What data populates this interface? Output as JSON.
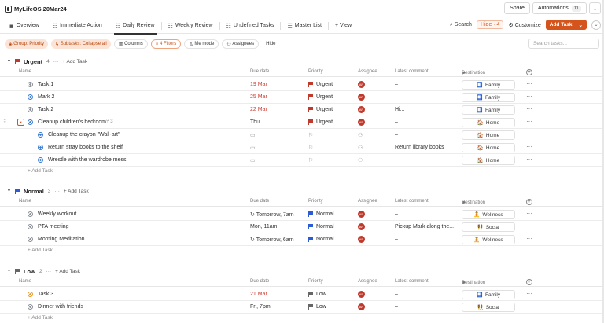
{
  "app": {
    "title": "MyLifeOS 20Mar24"
  },
  "top_actions": {
    "share": "Share",
    "automations": "Automations",
    "automations_count": "11"
  },
  "tabs": [
    {
      "label": "Overview",
      "icon": "▣"
    },
    {
      "label": "Immediate Action",
      "icon": "☷"
    },
    {
      "label": "Daily Review",
      "icon": "☷"
    },
    {
      "label": "Weekly Review",
      "icon": "☷"
    },
    {
      "label": "Undefined Tasks",
      "icon": "☷"
    },
    {
      "label": "Master List",
      "icon": "☰"
    },
    {
      "label": "+ View",
      "icon": ""
    }
  ],
  "tab_actions": {
    "search": "Search",
    "hide": "Hide · 4",
    "customize": "Customize",
    "add_task": "Add Task"
  },
  "filters": {
    "group": "Group: Priority",
    "subtasks": "Subtasks: Collapse all",
    "columns": "Columns",
    "filters": "4 Filters",
    "me_mode": "Me mode",
    "assignees": "Assignees",
    "hide": "Hide",
    "search_placeholder": "Search tasks..."
  },
  "columns": {
    "name": "Name",
    "due": "Due date",
    "priority": "Priority",
    "assignee": "Assignee",
    "comment": "Latest comment",
    "destination": "Destination"
  },
  "add_task_label": "+ Add Task",
  "add_row_label": "+ Add Task",
  "groups": [
    {
      "name": "Urgent",
      "count": "4",
      "color": "#c0392b",
      "rows": [
        {
          "name": "Task 1",
          "due": "19 Mar",
          "priority": "Urgent",
          "assignee": "AR",
          "comment": "–",
          "destination": "Family",
          "dest_icon": "🛄"
        },
        {
          "name": "Mark 2",
          "due": "25 Mar",
          "priority": "Urgent",
          "assignee": "AR",
          "comment": "–",
          "destination": "Family",
          "dest_icon": "🛄"
        },
        {
          "name": "Task 2",
          "due": "22 Mar",
          "priority": "Urgent",
          "assignee": "AR",
          "comment": "Hi...",
          "destination": "Family",
          "dest_icon": "🛄"
        },
        {
          "name": "Cleanup children's bedroom",
          "subcount": "3",
          "due": "Thu",
          "priority": "Urgent",
          "assignee": "AR",
          "comment": "–",
          "destination": "Home",
          "dest_icon": "🏠"
        },
        {
          "name": "Cleanup the crayon \"Wall-art\"",
          "due": "",
          "priority": "",
          "assignee": "",
          "comment": "–",
          "destination": "Home",
          "dest_icon": "🏠"
        },
        {
          "name": "Return stray books to the shelf",
          "due": "",
          "priority": "",
          "assignee": "",
          "comment": "Return library books",
          "destination": "Home",
          "dest_icon": "🏠"
        },
        {
          "name": "Wrestle with the wardrobe mess",
          "due": "",
          "priority": "",
          "assignee": "",
          "comment": "–",
          "destination": "Home",
          "dest_icon": "🏠"
        }
      ]
    },
    {
      "name": "Normal",
      "count": "3",
      "color": "#2d5bd6",
      "rows": [
        {
          "name": "Weekly workout",
          "due": "Tomorrow, 7am",
          "priority": "Normal",
          "assignee": "AR",
          "comment": "–",
          "destination": "Wellness",
          "dest_icon": "🧘"
        },
        {
          "name": "PTA meeting",
          "due": "Mon, 11am",
          "priority": "Normal",
          "assignee": "AR",
          "comment": "Pickup Mark along the...",
          "destination": "Social",
          "dest_icon": "👯"
        },
        {
          "name": "Morning Meditation",
          "due": "Tomorrow, 6am",
          "priority": "Normal",
          "assignee": "AR",
          "comment": "–",
          "destination": "Wellness",
          "dest_icon": "🧘"
        }
      ]
    },
    {
      "name": "Low",
      "count": "2",
      "color": "#666666",
      "rows": [
        {
          "name": "Task 3",
          "due": "21 Mar",
          "priority": "Low",
          "assignee": "AR",
          "comment": "–",
          "destination": "Family",
          "dest_icon": "🛄"
        },
        {
          "name": "Dinner with friends",
          "due": "Fri, 7pm",
          "priority": "Low",
          "assignee": "AR",
          "comment": "–",
          "destination": "Social",
          "dest_icon": "👯"
        }
      ]
    }
  ]
}
